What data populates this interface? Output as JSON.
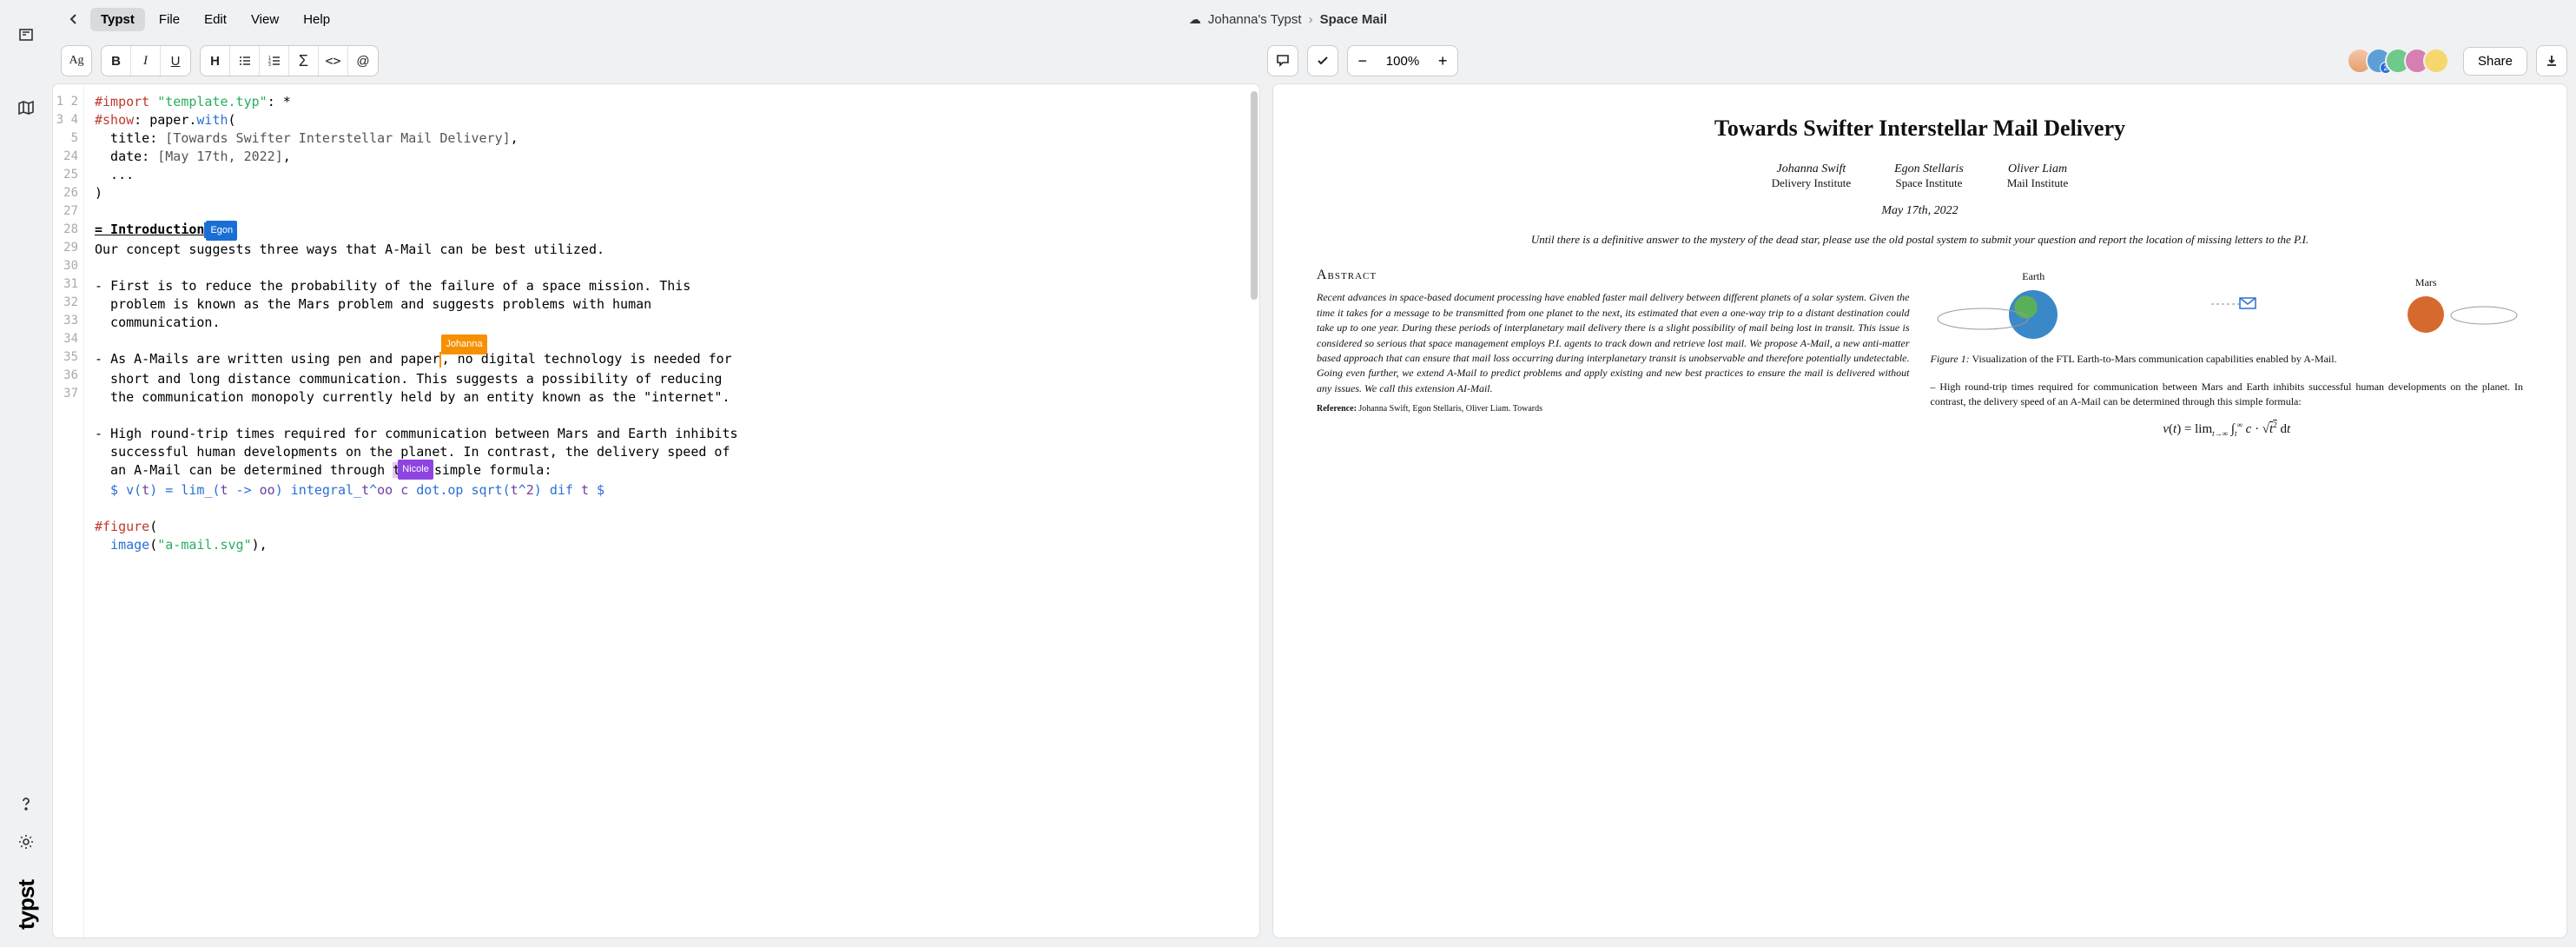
{
  "menubar": {
    "items": [
      "Typst",
      "File",
      "Edit",
      "View",
      "Help"
    ],
    "breadcrumb_root": "Johanna's Typst",
    "breadcrumb_sep": "›",
    "breadcrumb_current": "Space Mail"
  },
  "toolbar": {
    "font_indicator": "Ag",
    "zoom_pct": "100%",
    "share_label": "Share",
    "avatar_badge": "2"
  },
  "editor": {
    "line_numbers": [
      "1",
      "2",
      "3",
      "4",
      "5",
      "24",
      "25",
      "26",
      "27",
      "28",
      "29",
      "",
      "30",
      "31",
      "",
      "32",
      "33",
      "",
      "34",
      "35",
      "36",
      "37"
    ],
    "cursors": {
      "egon": "Egon",
      "johanna": "Johanna",
      "nicole": "Nicole"
    },
    "code": {
      "l1a": "#import",
      "l1b": "\"template.typ\"",
      "l1c": ": *",
      "l2a": "#show",
      "l2b": ": paper.",
      "l2c": "with",
      "l2d": "(",
      "l3a": "  title: ",
      "l3b": "[Towards Swifter Interstellar Mail Delivery]",
      "l3c": ",",
      "l4a": "  date: ",
      "l4b": "[May 17th, 2022]",
      "l4c": ",",
      "l5": "  ...",
      "l24": ")",
      "l26": "= Introduction",
      "l27": "Our concept suggests three ways that A-Mail can be best utilized.",
      "l29a": "- ",
      "l29b": "First is to reduce the probability of the failure of a space mission. This\n  problem is known as the Mars problem and suggests problems with human\n  communication.",
      "l31a": "- ",
      "l31b1": "As A-Mails are written using pen and paper",
      "l31b2": ", no digital technology is needed for\n  short and long distance communication. This suggests a possibility of reducing\n  the communication monopoly currently held by an entity known as the \"internet\".",
      "l33a": "- ",
      "l33b1": "High round-trip times required for communication between Mars and Earth inhibits\n  successful human developments on the planet. In contrast, the delivery speed of\n  an A-Mail can be determined through ",
      "l33b2": "this",
      "l33b3": " simple formula:",
      "l34a": "  $ ",
      "l34v": "v",
      "l34b": "(",
      "l34t1": "t",
      "l34c": ") = ",
      "l34lim": "lim",
      "l34d": "_(",
      "l34t2": "t",
      "l34e": " -> ",
      "l34oo1": "oo",
      "l34f": ") ",
      "l34int": "integral",
      "l34g": "_",
      "l34t3": "t",
      "l34h": "^",
      "l34oo2": "oo",
      "l34sp": " ",
      "l34cc": "c",
      "l34i": " ",
      "l34dot": "dot.op",
      "l34j": " ",
      "l34sqrt": "sqrt",
      "l34k": "(",
      "l34t4": "t",
      "l34l": "^",
      "l34n2": "2",
      "l34m": ") ",
      "l34dif": "dif",
      "l34n": " ",
      "l34t5": "t",
      "l34o": " $",
      "l36a": "#figure",
      "l36b": "(",
      "l37a": "  ",
      "l37b": "image",
      "l37c": "(",
      "l37d": "\"a-mail.svg\"",
      "l37e": "),"
    }
  },
  "preview": {
    "title": "Towards Swifter Interstellar Mail Delivery",
    "authors": [
      {
        "name": "Johanna Swift",
        "inst": "Delivery Institute"
      },
      {
        "name": "Egon Stellaris",
        "inst": "Space Institute"
      },
      {
        "name": "Oliver Liam",
        "inst": "Mail Institute"
      }
    ],
    "date": "May 17th, 2022",
    "notice": "Until there is a definitive answer to the mystery of the dead star, please use the old postal system to submit your question and report the location of missing letters to the P.I.",
    "abstract_heading": "Abstract",
    "abstract": "Recent advances in space-based document processing have enabled faster mail delivery between different planets of a solar system. Given the time it takes for a message to be transmitted from one planet to the next, its estimated that even a one-way trip to a distant destination could take up to one year. During these periods of interplanetary mail delivery there is a slight possibility of mail being lost in transit. This issue is considered so serious that space management employs P.I. agents to track down and retrieve lost mail. We propose A-Mail, a new anti-matter based approach that can ensure that mail loss occurring during interplanetary transit is unobservable and therefore potentially undetectable. Going even further, we extend A-Mail to predict problems and apply existing and new best practices to ensure the mail is delivered without any issues. We call this extension AI-Mail.",
    "reference_label": "Reference:",
    "reference": "Johanna Swift, Egon Stellaris, Oliver Liam. Towards",
    "planet_earth": "Earth",
    "planet_mars": "Mars",
    "caption_label": "Figure 1:",
    "caption": "Visualization of the FTL Earth-to-Mars communication capabilities enabled by A-Mail.",
    "bullet": "High round-trip times required for communication between Mars and Earth inhibits successful human developments on the planet. In contrast, the delivery speed of an A-Mail can be determined through this simple formula:",
    "formula": "v(t) = lim∫ c · √t² dt"
  }
}
